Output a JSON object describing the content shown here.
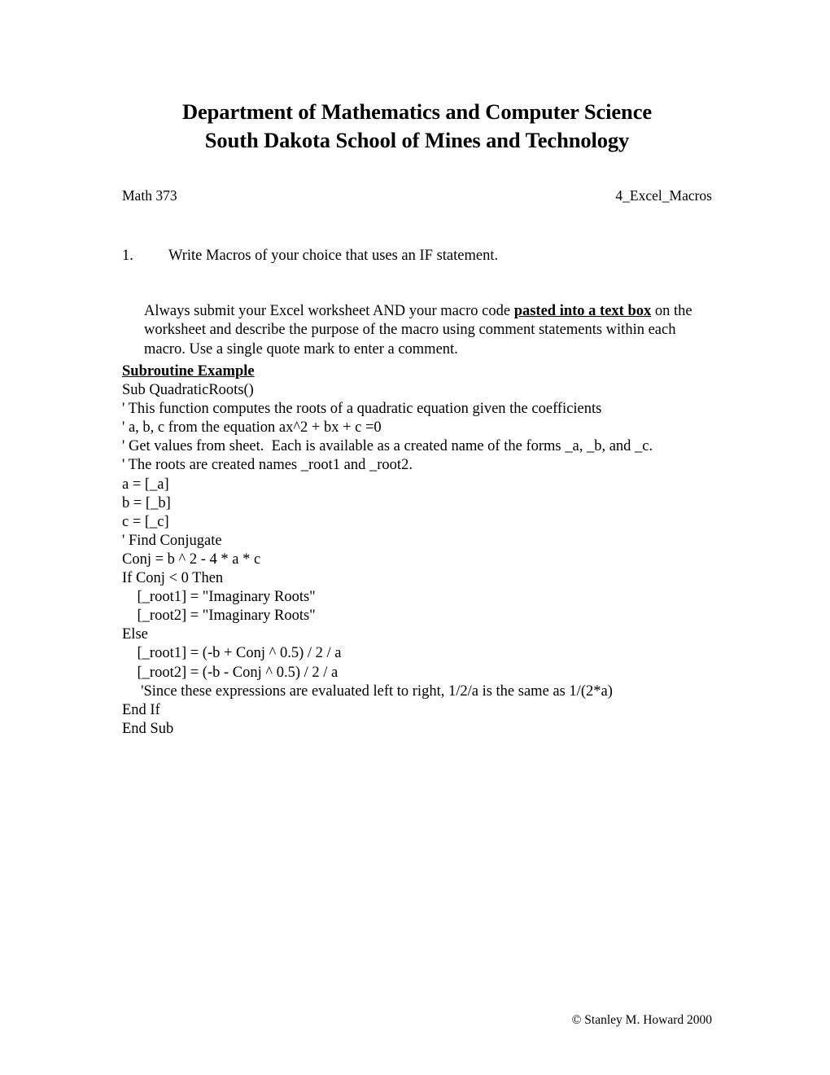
{
  "document": {
    "title_lines": [
      "Department of Mathematics and Computer Science",
      "South Dakota School of Mines and Technology"
    ],
    "course": "Math 373",
    "assignment": "4_Excel_Macros",
    "footer": "© Stanley M. Howard 2000"
  },
  "task": {
    "number": "1.",
    "text": "Write Macros of your choice that uses an IF statement."
  },
  "instructions": {
    "before_bold": "Always submit your Excel worksheet AND your macro code ",
    "bold_underlined": "pasted into a text box",
    "after_bold": " on the worksheet and describe the purpose of the macro using comment statements within each macro.  Use a single quote mark to enter a comment."
  },
  "code": {
    "heading": "Subroutine Example",
    "lines": [
      "Sub QuadraticRoots()",
      "' This function computes the roots of a quadratic equation given the coefficients",
      "' a, b, c from the equation ax^2 + bx + c =0",
      "' Get values from sheet.  Each is available as a created name of the forms _a, _b, and _c.",
      "' The roots are created names _root1 and _root2.",
      "a = [_a]",
      "b = [_b]",
      "c = [_c]",
      "' Find Conjugate",
      "Conj = b ^ 2 - 4 * a * c",
      "If Conj < 0 Then",
      "    [_root1] = \"Imaginary Roots\"",
      "    [_root2] = \"Imaginary Roots\"",
      "Else",
      "    [_root1] = (-b + Conj ^ 0.5) / 2 / a",
      "    [_root2] = (-b - Conj ^ 0.5) / 2 / a",
      "     'Since these expressions are evaluated left to right, 1/2/a is the same as 1/(2*a)",
      "End If",
      "End Sub"
    ]
  }
}
